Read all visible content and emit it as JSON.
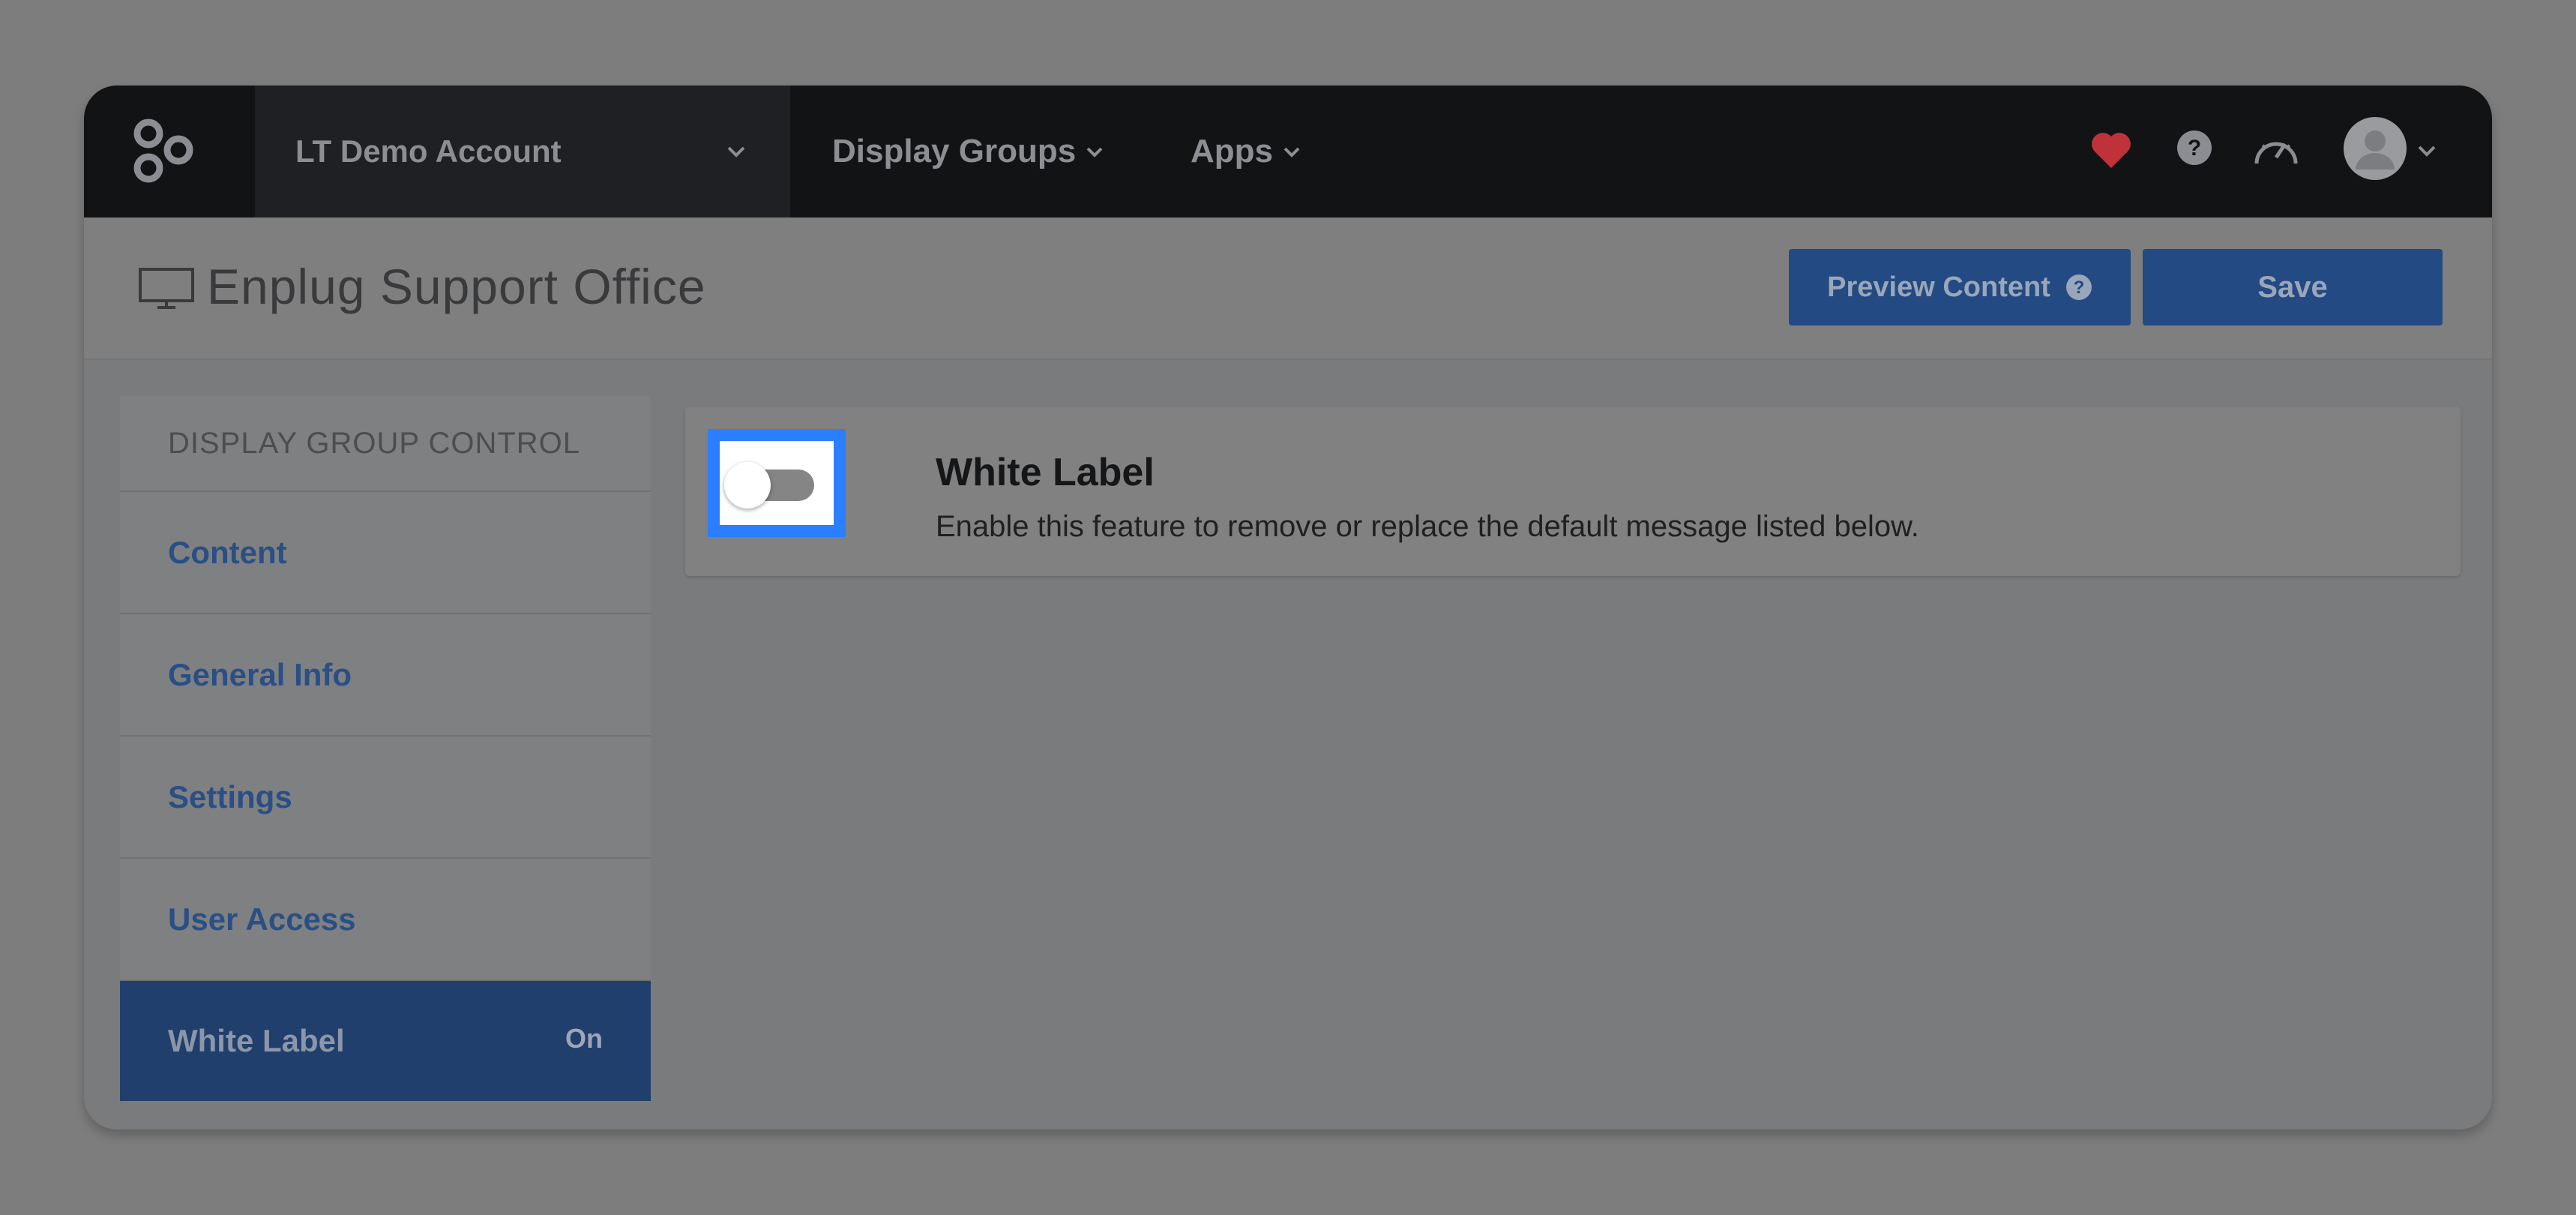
{
  "topbar": {
    "account_name": "LT Demo Account",
    "nav": [
      {
        "label": "Display Groups"
      },
      {
        "label": "Apps"
      }
    ],
    "icons": [
      "logo-icon",
      "heart-icon",
      "help-icon",
      "dashboard-gauge-icon",
      "avatar",
      "chevron-down-icon"
    ]
  },
  "header": {
    "title": "Enplug Support Office",
    "preview_label": "Preview Content",
    "save_label": "Save"
  },
  "sidebar": {
    "heading": "DISPLAY GROUP CONTROL",
    "items": [
      {
        "label": "Content"
      },
      {
        "label": "General Info"
      },
      {
        "label": "Settings"
      },
      {
        "label": "User Access"
      },
      {
        "label": "White Label",
        "badge": "On",
        "active": true
      }
    ]
  },
  "main": {
    "title": "White Label",
    "description": "Enable this feature to remove or replace the default message listed below.",
    "toggle_state": "off"
  },
  "colors": {
    "accent": "#2b7fff",
    "button": "#234a82",
    "heart": "#c0323a"
  }
}
